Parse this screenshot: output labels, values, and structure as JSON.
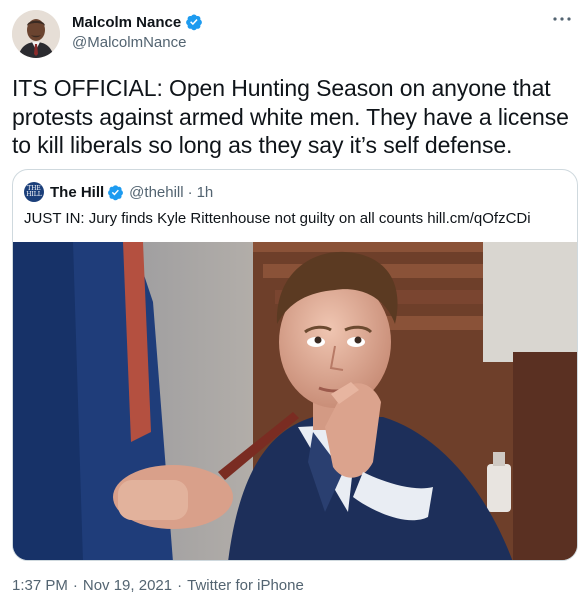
{
  "author": {
    "display_name": "Malcolm Nance",
    "handle": "@MalcolmNance",
    "verified": true,
    "avatar_icon": "profile-photo"
  },
  "tweet": {
    "text": "ITS OFFICIAL: Open Hunting Season on anyone that protests against armed white men.  They have a license to kill liberals so long as they say it’s self defense."
  },
  "quoted_tweet": {
    "display_name": "The Hill",
    "logo_text": "THE HILL",
    "handle": "@thehill",
    "separator": "·",
    "time": "1h",
    "verified": true,
    "text": "JUST IN: Jury finds Kyle Rittenhouse not guilty on all counts hill.cm/qOfzCDi",
    "image_icon": "courtroom-photo"
  },
  "meta": {
    "time": "1:37 PM",
    "date": "Nov 19, 2021",
    "source": "Twitter for iPhone",
    "separator": "·"
  },
  "colors": {
    "verified_blue": "#1d9bf0",
    "secondary_text": "#536471",
    "border": "#cfd9de"
  }
}
